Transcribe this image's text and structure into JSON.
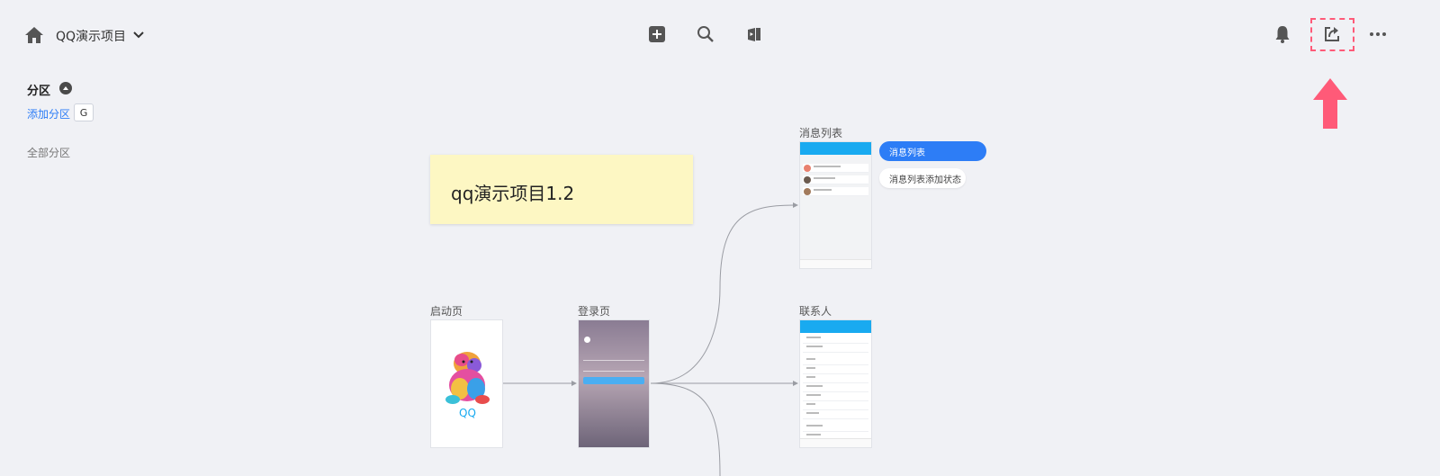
{
  "header": {
    "project_title": "QQ演示项目",
    "icons": [
      "home-icon",
      "chevron-down-icon",
      "add-icon",
      "search-icon",
      "preview-icon",
      "bell-icon",
      "share-icon",
      "more-icon"
    ]
  },
  "sidebar": {
    "section_title": "分区",
    "add_section": "添加分区",
    "add_section_shortcut": "G",
    "all_sections": "全部分区"
  },
  "canvas": {
    "sticky_note": "qq演示项目1.2",
    "frames": {
      "splash": {
        "label": "启动页",
        "logo_text": "QQ"
      },
      "login": {
        "label": "登录页"
      },
      "messages": {
        "label": "消息列表"
      },
      "contacts": {
        "label": "联系人"
      }
    },
    "states": {
      "active": "消息列表",
      "added": "消息列表添加状态"
    }
  },
  "colors": {
    "accent": "#2d7df6",
    "highlight": "#ff5a78",
    "sticky": "#fdf7c3",
    "qq_blue": "#19aaf0"
  }
}
